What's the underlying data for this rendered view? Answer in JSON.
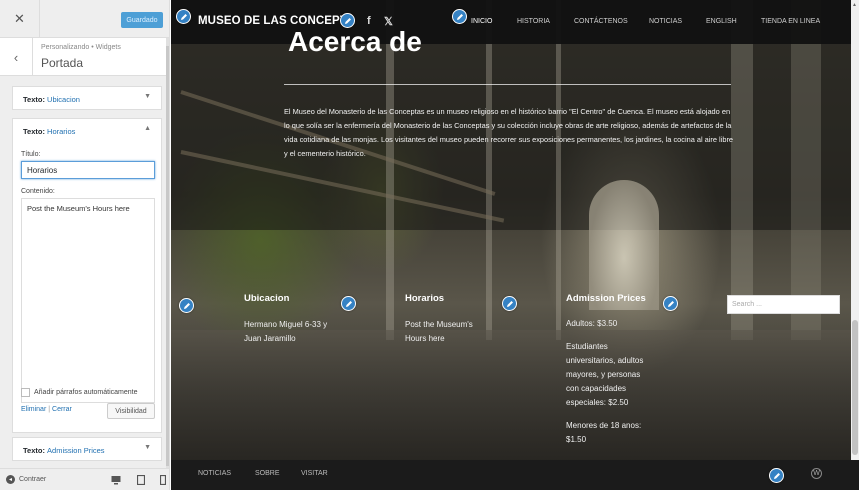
{
  "sidebar": {
    "close_glyph": "✕",
    "saved_label": "Guardado",
    "back_glyph": "‹",
    "breadcrumb": "Personalizando • Widgets",
    "section_title": "Portada",
    "widget_ubicacion": {
      "prefix": "Texto: ",
      "value": "Ubicacion",
      "arrow": "▼"
    },
    "widget_horarios": {
      "prefix": "Texto: ",
      "value": "Horarios",
      "arrow": "▲"
    },
    "form": {
      "title_label": "Título:",
      "title_value": "Horarios",
      "content_label": "Contenido:",
      "content_value": "Post the Museum's Hours here",
      "auto_paragraph_label": "Añadir párrafos automáticamente",
      "delete_label": "Eliminar",
      "separator": "|",
      "close_label": "Cerrar",
      "visibility_label": "Visibilidad"
    },
    "widget_admission": {
      "prefix": "Texto: ",
      "value": "Admission Prices",
      "arrow": "▼"
    },
    "collapse_label": "Contraer"
  },
  "site": {
    "brand": "MUSEO DE LAS CONCEPTA",
    "social": [
      "f",
      "𝕏"
    ],
    "nav": [
      "INICIO",
      "HISTORIA",
      "CONTÁCTENOS",
      "NOTICIAS",
      "ENGLISH",
      "TIENDA EN LINEA"
    ],
    "hero_title": "Acerca de",
    "about_text": "El Museo del Monasterio de las Conceptas es un museo religioso en el histórico barrio \"El Centro\" de Cuenca. El museo está alojado en lo que solía ser la enfermería del Monasterio de las Conceptas y su colección incluye obras de arte religioso, además de artefactos de la vida cotidiana de las monjas. Los visitantes del museo pueden recorrer sus exposiciones permanentes, los jardines, la cocina al aire libre y el cementerio histórico.",
    "widgets": {
      "ubicacion": {
        "title": "Ubicacion",
        "lines": [
          "Hermano Miguel 6-33 y",
          "Juan Jaramillo"
        ]
      },
      "horarios": {
        "title": "Horarios",
        "lines": [
          "Post the Museum's",
          "Hours here"
        ]
      },
      "admission": {
        "title": "Admission Prices",
        "p1": "Adultos: $3.50",
        "p2": [
          "Estudiantes",
          "universitarios, adultos",
          "mayores, y personas",
          "con capacidades",
          "especiales: $2.50"
        ],
        "p3": [
          "Menores de 18 anos:",
          "$1.50"
        ]
      },
      "search_placeholder": "Search ..."
    },
    "footer": [
      "NOTICIAS",
      "SOBRE",
      "VISITAR"
    ],
    "footer_wp_glyph": "W"
  },
  "colors": {
    "accent": "#3582c4",
    "nav_bg": "#121212",
    "link": "#2271b1"
  },
  "icons": [
    "close-icon",
    "back-chevron-icon",
    "pencil-edit-icon",
    "facebook-icon",
    "twitter-icon",
    "desktop-icon",
    "tablet-icon",
    "mobile-icon",
    "wordpress-icon"
  ]
}
